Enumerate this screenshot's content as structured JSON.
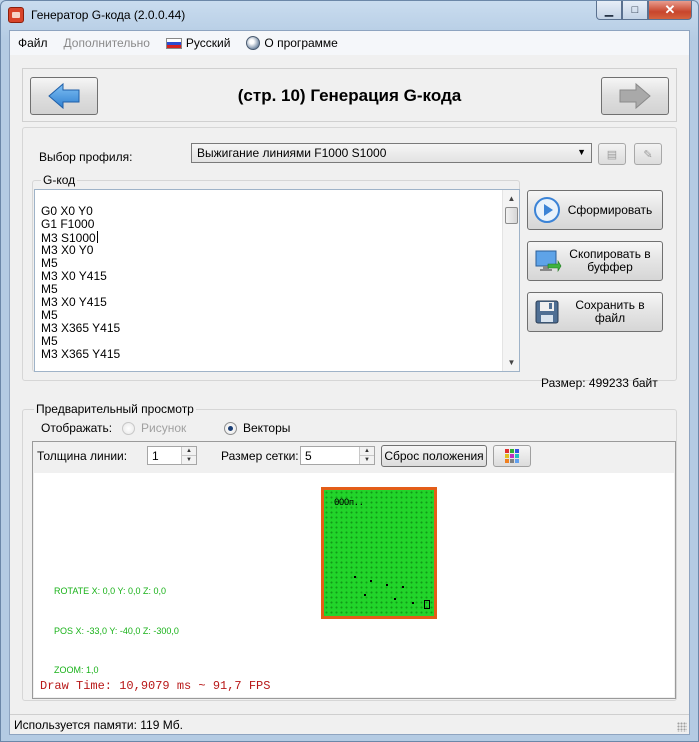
{
  "window": {
    "title": "Генератор G-кода (2.0.0.44)",
    "controls": {
      "minimize": "▁",
      "maximize": "□",
      "close": "✕"
    }
  },
  "menu": {
    "file": "Файл",
    "additional": "Дополнительно",
    "language": "Русский",
    "about": "О программе"
  },
  "header": {
    "title": "(стр. 10) Генерация G-кода",
    "back_icon": "arrow-left-icon",
    "next_icon": "arrow-right-icon"
  },
  "profile": {
    "label": "Выбор профиля:",
    "selected": "Выжигание линиями F1000 S1000"
  },
  "gcode": {
    "legend": "G-код",
    "lines": [
      "G0 X0 Y0",
      "G1 F1000",
      "M3 S1000",
      "M3 X0 Y0",
      "M5",
      "M3 X0 Y415",
      "M5",
      "M3 X0 Y415",
      "M5",
      "M3 X365 Y415",
      "M5",
      "M3 X365 Y415"
    ]
  },
  "actions": {
    "generate": "Сформировать",
    "copy": "Скопировать в буффер",
    "save": "Сохранить в файл",
    "size": "Размер: 499233 байт"
  },
  "preview": {
    "legend": "Предварительный просмотр",
    "display_label": "Отображать:",
    "option_picture": "Рисунок",
    "option_vectors": "Векторы",
    "selected": "vectors",
    "line_width_label": "Толщина линии:",
    "line_width": "1",
    "grid_size_label": "Размер сетки:",
    "grid_size": "5",
    "reset_button": "Сброс положения",
    "workarea_marks": "ΘOOп.."
  },
  "viewport": {
    "rotate": "ROTATE X: 0,0  Y: 0,0 Z: 0,0",
    "pos": "POS X: -33,0  Y: -40,0 Z: -300,0",
    "zoom": "ZOOM: 1,0",
    "draw_time": "Draw Time: 10,9079 ms ~ 91,7 FPS"
  },
  "status": {
    "memory": "Используется памяти:  119  Мб."
  },
  "colors": {
    "accent_blue": "#3b83d6",
    "workarea_fill": "#22d42a",
    "workarea_border": "#e35d18",
    "overlay_green": "#19b219",
    "fps_red": "#b81818"
  }
}
